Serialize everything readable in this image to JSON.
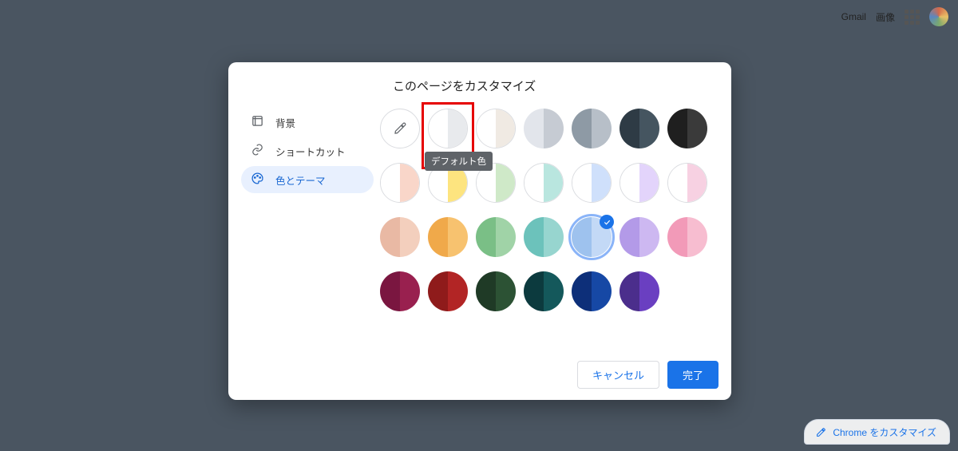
{
  "header": {
    "gmail": "Gmail",
    "images": "画像"
  },
  "customize_pill": "Chrome をカスタマイズ",
  "dialog": {
    "title": "このページをカスタマイズ",
    "sidebar": [
      {
        "id": "background",
        "label": "背景",
        "icon": "image-frame-icon",
        "active": false
      },
      {
        "id": "shortcuts",
        "label": "ショートカット",
        "icon": "link-icon",
        "active": false
      },
      {
        "id": "color",
        "label": "色とテーマ",
        "icon": "palette-icon",
        "active": true
      }
    ],
    "tooltip": "デフォルト色",
    "highlighted_swatch_index": 1,
    "selected_swatch_index": 18,
    "swatches": [
      {
        "kind": "picker"
      },
      {
        "left": "#ffffff",
        "right": "#e8eaed",
        "outlined": true
      },
      {
        "left": "#ffffff",
        "right": "#f0eae3",
        "outlined": true
      },
      {
        "left": "#e2e5eb",
        "right": "#c6cbd3"
      },
      {
        "left": "#8e9aa5",
        "right": "#b7bfc8"
      },
      {
        "left": "#2e3b45",
        "right": "#455560"
      },
      {
        "left": "#1f1f1f",
        "right": "#3a3a3a"
      },
      {
        "left": "#ffffff",
        "right": "#f9d6c9",
        "outlined": true
      },
      {
        "left": "#ffffff",
        "right": "#fde47f",
        "outlined": true
      },
      {
        "left": "#ffffff",
        "right": "#cfe9c8",
        "outlined": true
      },
      {
        "left": "#ffffff",
        "right": "#b9e6df",
        "outlined": true
      },
      {
        "left": "#ffffff",
        "right": "#cfe0fb",
        "outlined": true
      },
      {
        "left": "#ffffff",
        "right": "#e3d4fb",
        "outlined": true
      },
      {
        "left": "#ffffff",
        "right": "#f7d1e2",
        "outlined": true
      },
      {
        "left": "#e9b9a4",
        "right": "#f3cfbd"
      },
      {
        "left": "#f0a94a",
        "right": "#f7c26f"
      },
      {
        "left": "#7abf86",
        "right": "#a0d3a7"
      },
      {
        "left": "#6cc2bb",
        "right": "#97d5cf"
      },
      {
        "left": "#9ec2ee",
        "right": "#c3d9f6"
      },
      {
        "left": "#b39ae8",
        "right": "#cdb8f1"
      },
      {
        "left": "#f29ab8",
        "right": "#f7bdd0"
      },
      {
        "left": "#7a1640",
        "right": "#99204f"
      },
      {
        "left": "#8f1b1b",
        "right": "#b22525"
      },
      {
        "left": "#1f3a26",
        "right": "#2c5234"
      },
      {
        "left": "#0c3a3e",
        "right": "#14585b"
      },
      {
        "left": "#0d2f79",
        "right": "#1648a5"
      },
      {
        "left": "#4b2e8c",
        "right": "#6a3fc1"
      }
    ],
    "buttons": {
      "cancel": "キャンセル",
      "done": "完了"
    }
  }
}
